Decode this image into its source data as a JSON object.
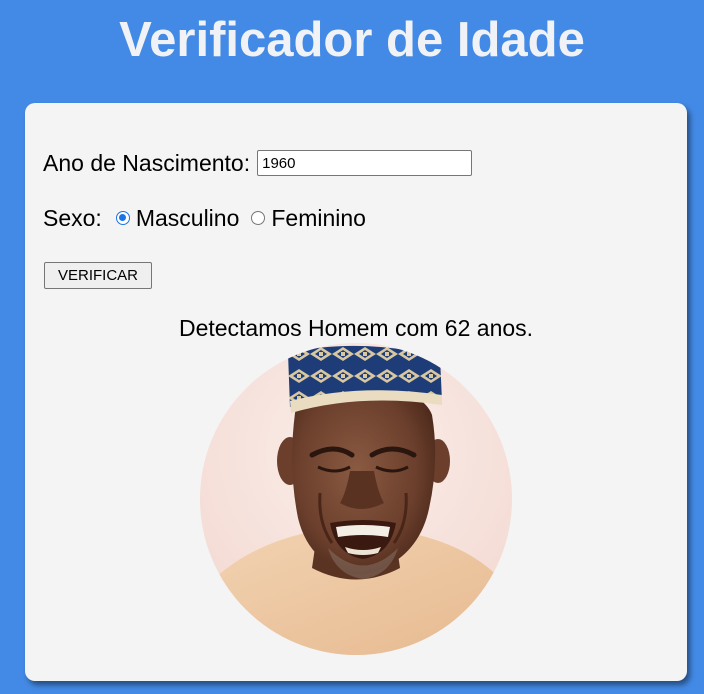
{
  "header": {
    "title": "Verificador de Idade"
  },
  "form": {
    "year_label": "Ano de Nascimento:",
    "year_value": "1960",
    "sex_label": "Sexo:",
    "options": [
      {
        "label": "Masculino",
        "checked": true
      },
      {
        "label": "Feminino",
        "checked": false
      }
    ],
    "button_label": "VERIFICAR"
  },
  "result": {
    "text": "Detectamos Homem com 62 anos."
  },
  "colors": {
    "background": "#438ae6",
    "card": "#f4f4f4",
    "radio_accent": "#1a73e8"
  },
  "icons": {
    "portrait": "elderly-man-photo"
  }
}
